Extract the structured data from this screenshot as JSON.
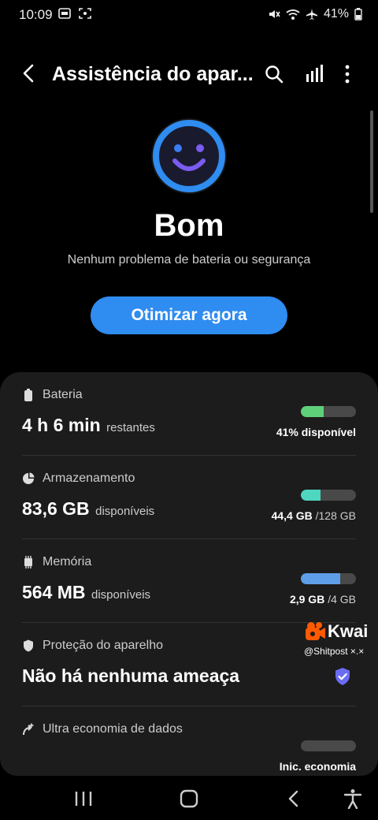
{
  "status_bar": {
    "time": "10:09",
    "battery_percent": "41%"
  },
  "app_bar": {
    "title": "Assistência do apar..."
  },
  "status": {
    "title": "Bom",
    "subtitle": "Nenhum problema de bateria ou segurança"
  },
  "optimize_button": "Otimizar agora",
  "items": {
    "battery": {
      "label": "Bateria",
      "value": "4 h 6 min",
      "unit": "restantes",
      "right": "41% disponível",
      "level": 0.41,
      "color": "#5ed07a"
    },
    "storage": {
      "label": "Armazenamento",
      "value": "83,6 GB",
      "unit": "disponíveis",
      "right_used": "44,4 GB",
      "right_total": "/128 GB",
      "level": 0.35,
      "color": "#4ed6c0"
    },
    "memory": {
      "label": "Memória",
      "value": "564 MB",
      "unit": "disponíveis",
      "right_used": "2,9 GB",
      "right_total": "/4 GB",
      "level": 0.72,
      "color": "#5e9ee8"
    },
    "protection": {
      "label": "Proteção do aparelho",
      "value": "Não há nenhuma ameaça"
    },
    "ultra": {
      "label": "Ultra economia de dados",
      "right": "Inic. economia",
      "level": 0
    }
  },
  "watermark": {
    "name": "Kwai",
    "handle": "@Shitpost ×.×"
  },
  "colors": {
    "accent": "#2f8cf0",
    "card": "#1c1c1c",
    "face_ring": "#2f8cf0",
    "face_inner": "#1a1a2e",
    "face_smile": "#7b5cf0"
  }
}
